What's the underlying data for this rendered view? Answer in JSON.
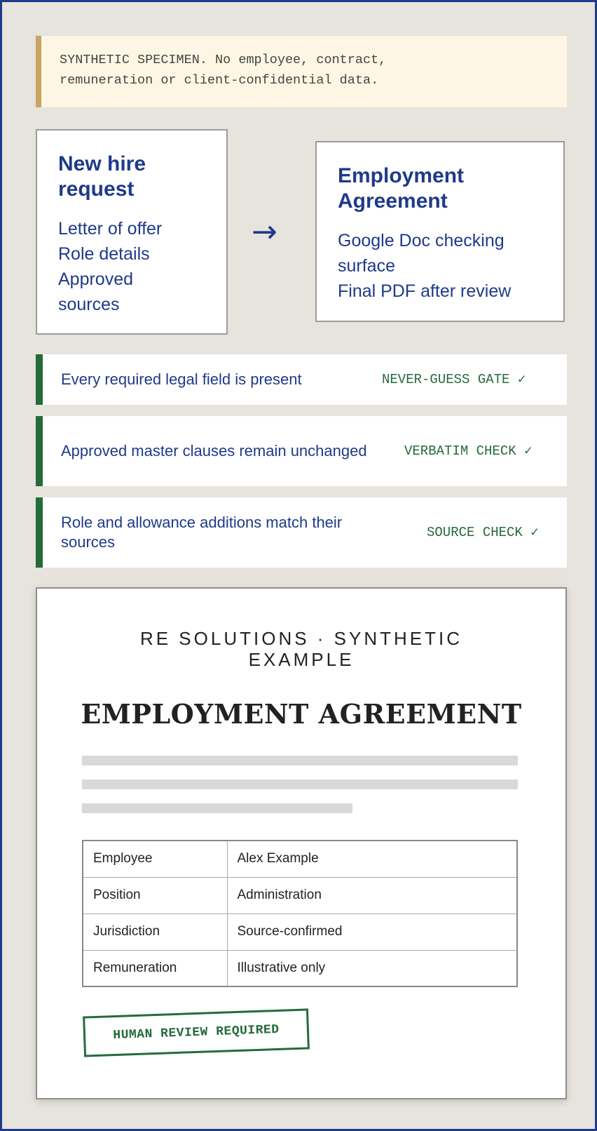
{
  "notice": {
    "line1": "SYNTHETIC SPECIMEN. No employee, contract,",
    "line2": "remuneration or client-confidential data."
  },
  "input_card": {
    "title_line1": "New hire",
    "title_line2": "request",
    "items": [
      "Letter of offer",
      "Role details",
      "Approved",
      "sources"
    ]
  },
  "flow_arrow": "→",
  "output_card": {
    "title_line1": "Employment",
    "title_line2": "Agreement",
    "items": [
      "Google Doc checking",
      "surface",
      "Final PDF after review"
    ]
  },
  "checks": [
    {
      "label": "Every required legal field is present",
      "tag": "NEVER-GUESS GATE ✓"
    },
    {
      "label": "Approved master clauses remain unchanged",
      "tag": "VERBATIM CHECK ✓"
    },
    {
      "label": "Role and allowance additions match their sources",
      "tag": "SOURCE CHECK ✓"
    }
  ],
  "document": {
    "eyebrow": "RE SOLUTIONS · SYNTHETIC EXAMPLE",
    "title": "EMPLOYMENT AGREEMENT",
    "fields": [
      {
        "key": "Employee",
        "value": "Alex Example"
      },
      {
        "key": "Position",
        "value": "Administration"
      },
      {
        "key": "Jurisdiction",
        "value": "Source-confirmed"
      },
      {
        "key": "Remuneration",
        "value": "Illustrative only"
      }
    ],
    "stamp": "HUMAN REVIEW REQUIRED"
  },
  "colors": {
    "accent_blue": "#1f3a8a",
    "check_green": "#246b3c",
    "notice_bar": "#c9a463",
    "background": "#e7e3dd"
  }
}
